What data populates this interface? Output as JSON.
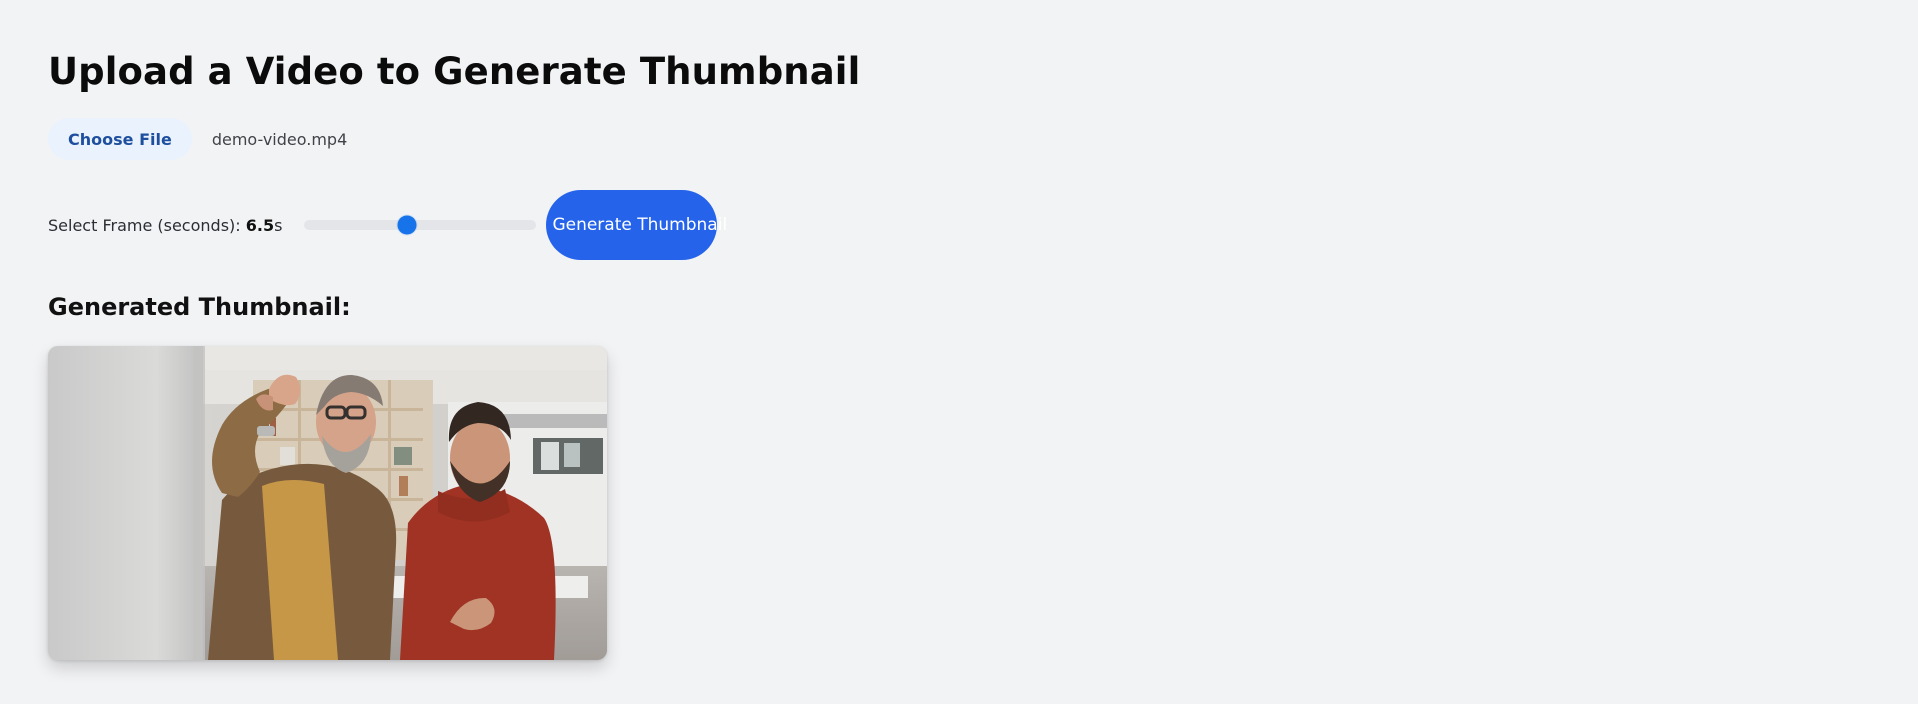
{
  "page": {
    "title": "Upload a Video to Generate Thumbnail"
  },
  "file_picker": {
    "button_label": "Choose File",
    "selected_file": "demo-video.mp4"
  },
  "frame_selector": {
    "label": "Select Frame (seconds): ",
    "value": "6.5",
    "unit": "s",
    "slider_fraction": 0.44
  },
  "actions": {
    "generate_label": "Generate Thumbnail"
  },
  "thumbnail_section": {
    "heading": "Generated Thumbnail:",
    "image_description": "Two men in an office, one with a beard and glasses waving, another in a red polo shirt"
  },
  "colors": {
    "background": "#f2f3f5",
    "primary": "#2563eb",
    "slider_thumb": "#1673ea",
    "file_button_bg": "#eaf2fd",
    "file_button_text": "#1e4f9f"
  }
}
